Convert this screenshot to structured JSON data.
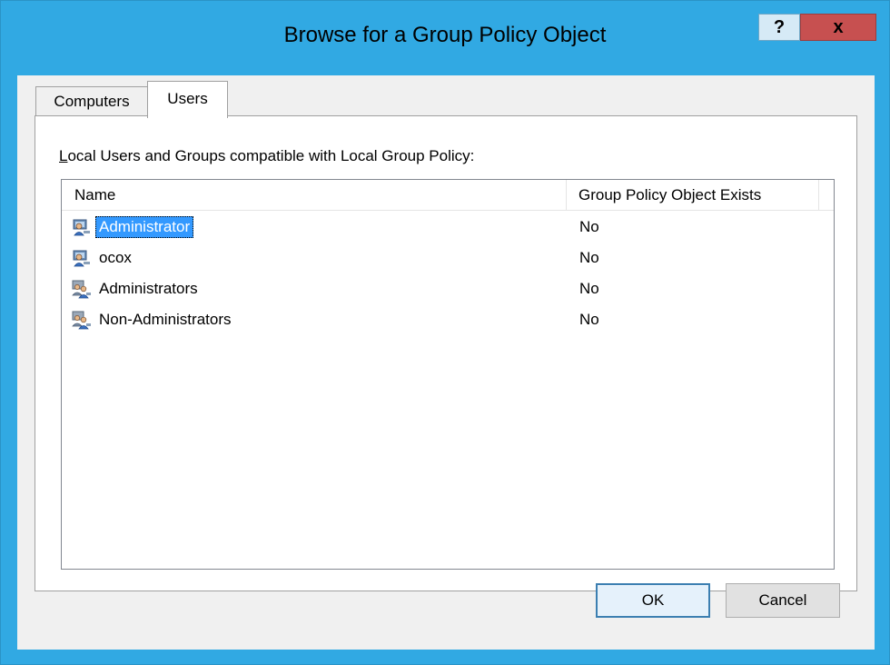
{
  "window": {
    "title": "Browse for a Group Policy Object",
    "help_label": "?",
    "close_label": "x"
  },
  "tabs": [
    {
      "label": "Computers",
      "selected": false
    },
    {
      "label": "Users",
      "selected": true
    }
  ],
  "panel": {
    "label": "Local Users and Groups compatible with Local Group Policy:"
  },
  "list": {
    "columns": [
      "Name",
      "Group Policy Object Exists"
    ],
    "rows": [
      {
        "name": "Administrator",
        "gpo_exists": "No",
        "icon": "user-icon",
        "selected": true
      },
      {
        "name": "ocox",
        "gpo_exists": "No",
        "icon": "user-icon",
        "selected": false
      },
      {
        "name": "Administrators",
        "gpo_exists": "No",
        "icon": "group-icon",
        "selected": false
      },
      {
        "name": "Non-Administrators",
        "gpo_exists": "No",
        "icon": "group-icon",
        "selected": false
      }
    ]
  },
  "buttons": {
    "ok": "OK",
    "cancel": "Cancel"
  },
  "colors": {
    "frame": "#31a9e3",
    "close": "#c75050",
    "selection": "#3399ff"
  }
}
